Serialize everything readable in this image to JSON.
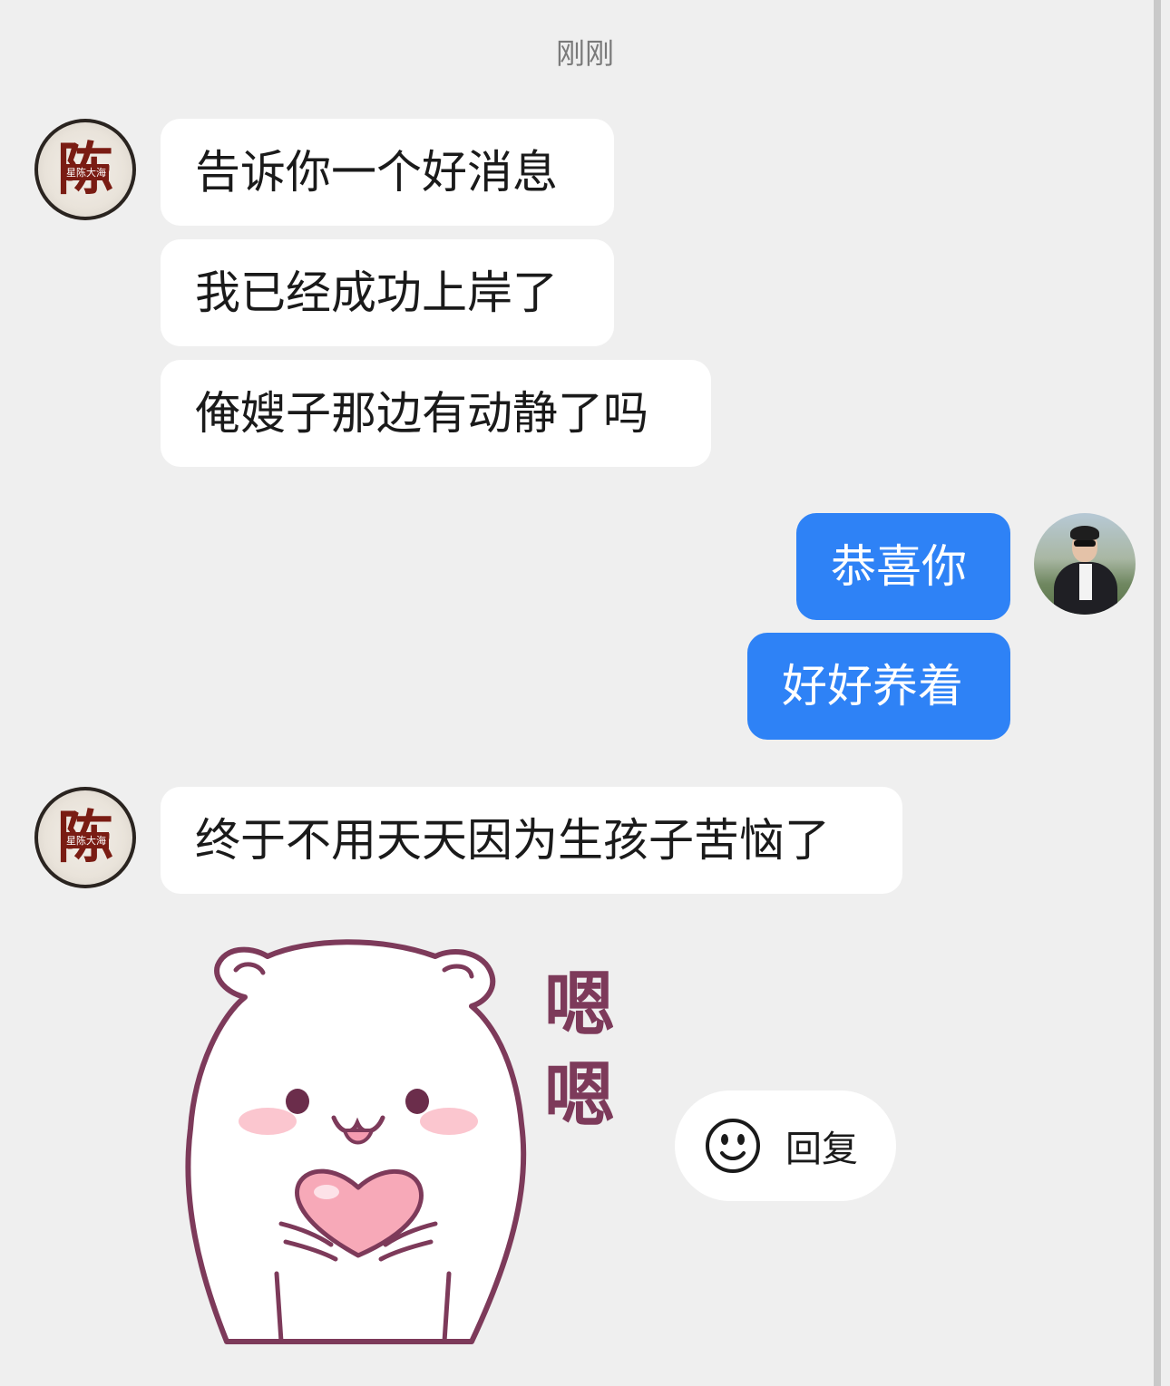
{
  "chat": {
    "timestamp": "刚刚",
    "contact_avatar_text": "陈",
    "contact_avatar_subtext": "星陈大海",
    "messages": [
      {
        "side": "in",
        "text": "告诉你一个好消息"
      },
      {
        "side": "in",
        "text": "我已经成功上岸了"
      },
      {
        "side": "in",
        "text": "俺嫂子那边有动静了吗"
      },
      {
        "side": "out",
        "text": "恭喜你"
      },
      {
        "side": "out",
        "text": "好好养着"
      },
      {
        "side": "in",
        "text": "终于不用天天因为生孩子苦恼了"
      }
    ],
    "sticker": {
      "caption_top": "嗯",
      "caption_bottom": "嗯"
    },
    "reply_button": {
      "label": "回复",
      "icon": "smile-icon"
    }
  },
  "colors": {
    "background": "#efefef",
    "bubble_in": "#ffffff",
    "bubble_out": "#2e82f6",
    "sticker_outline": "#7d3a5a",
    "heart": "#f7a9b8",
    "blush": "#fbc6cf"
  }
}
